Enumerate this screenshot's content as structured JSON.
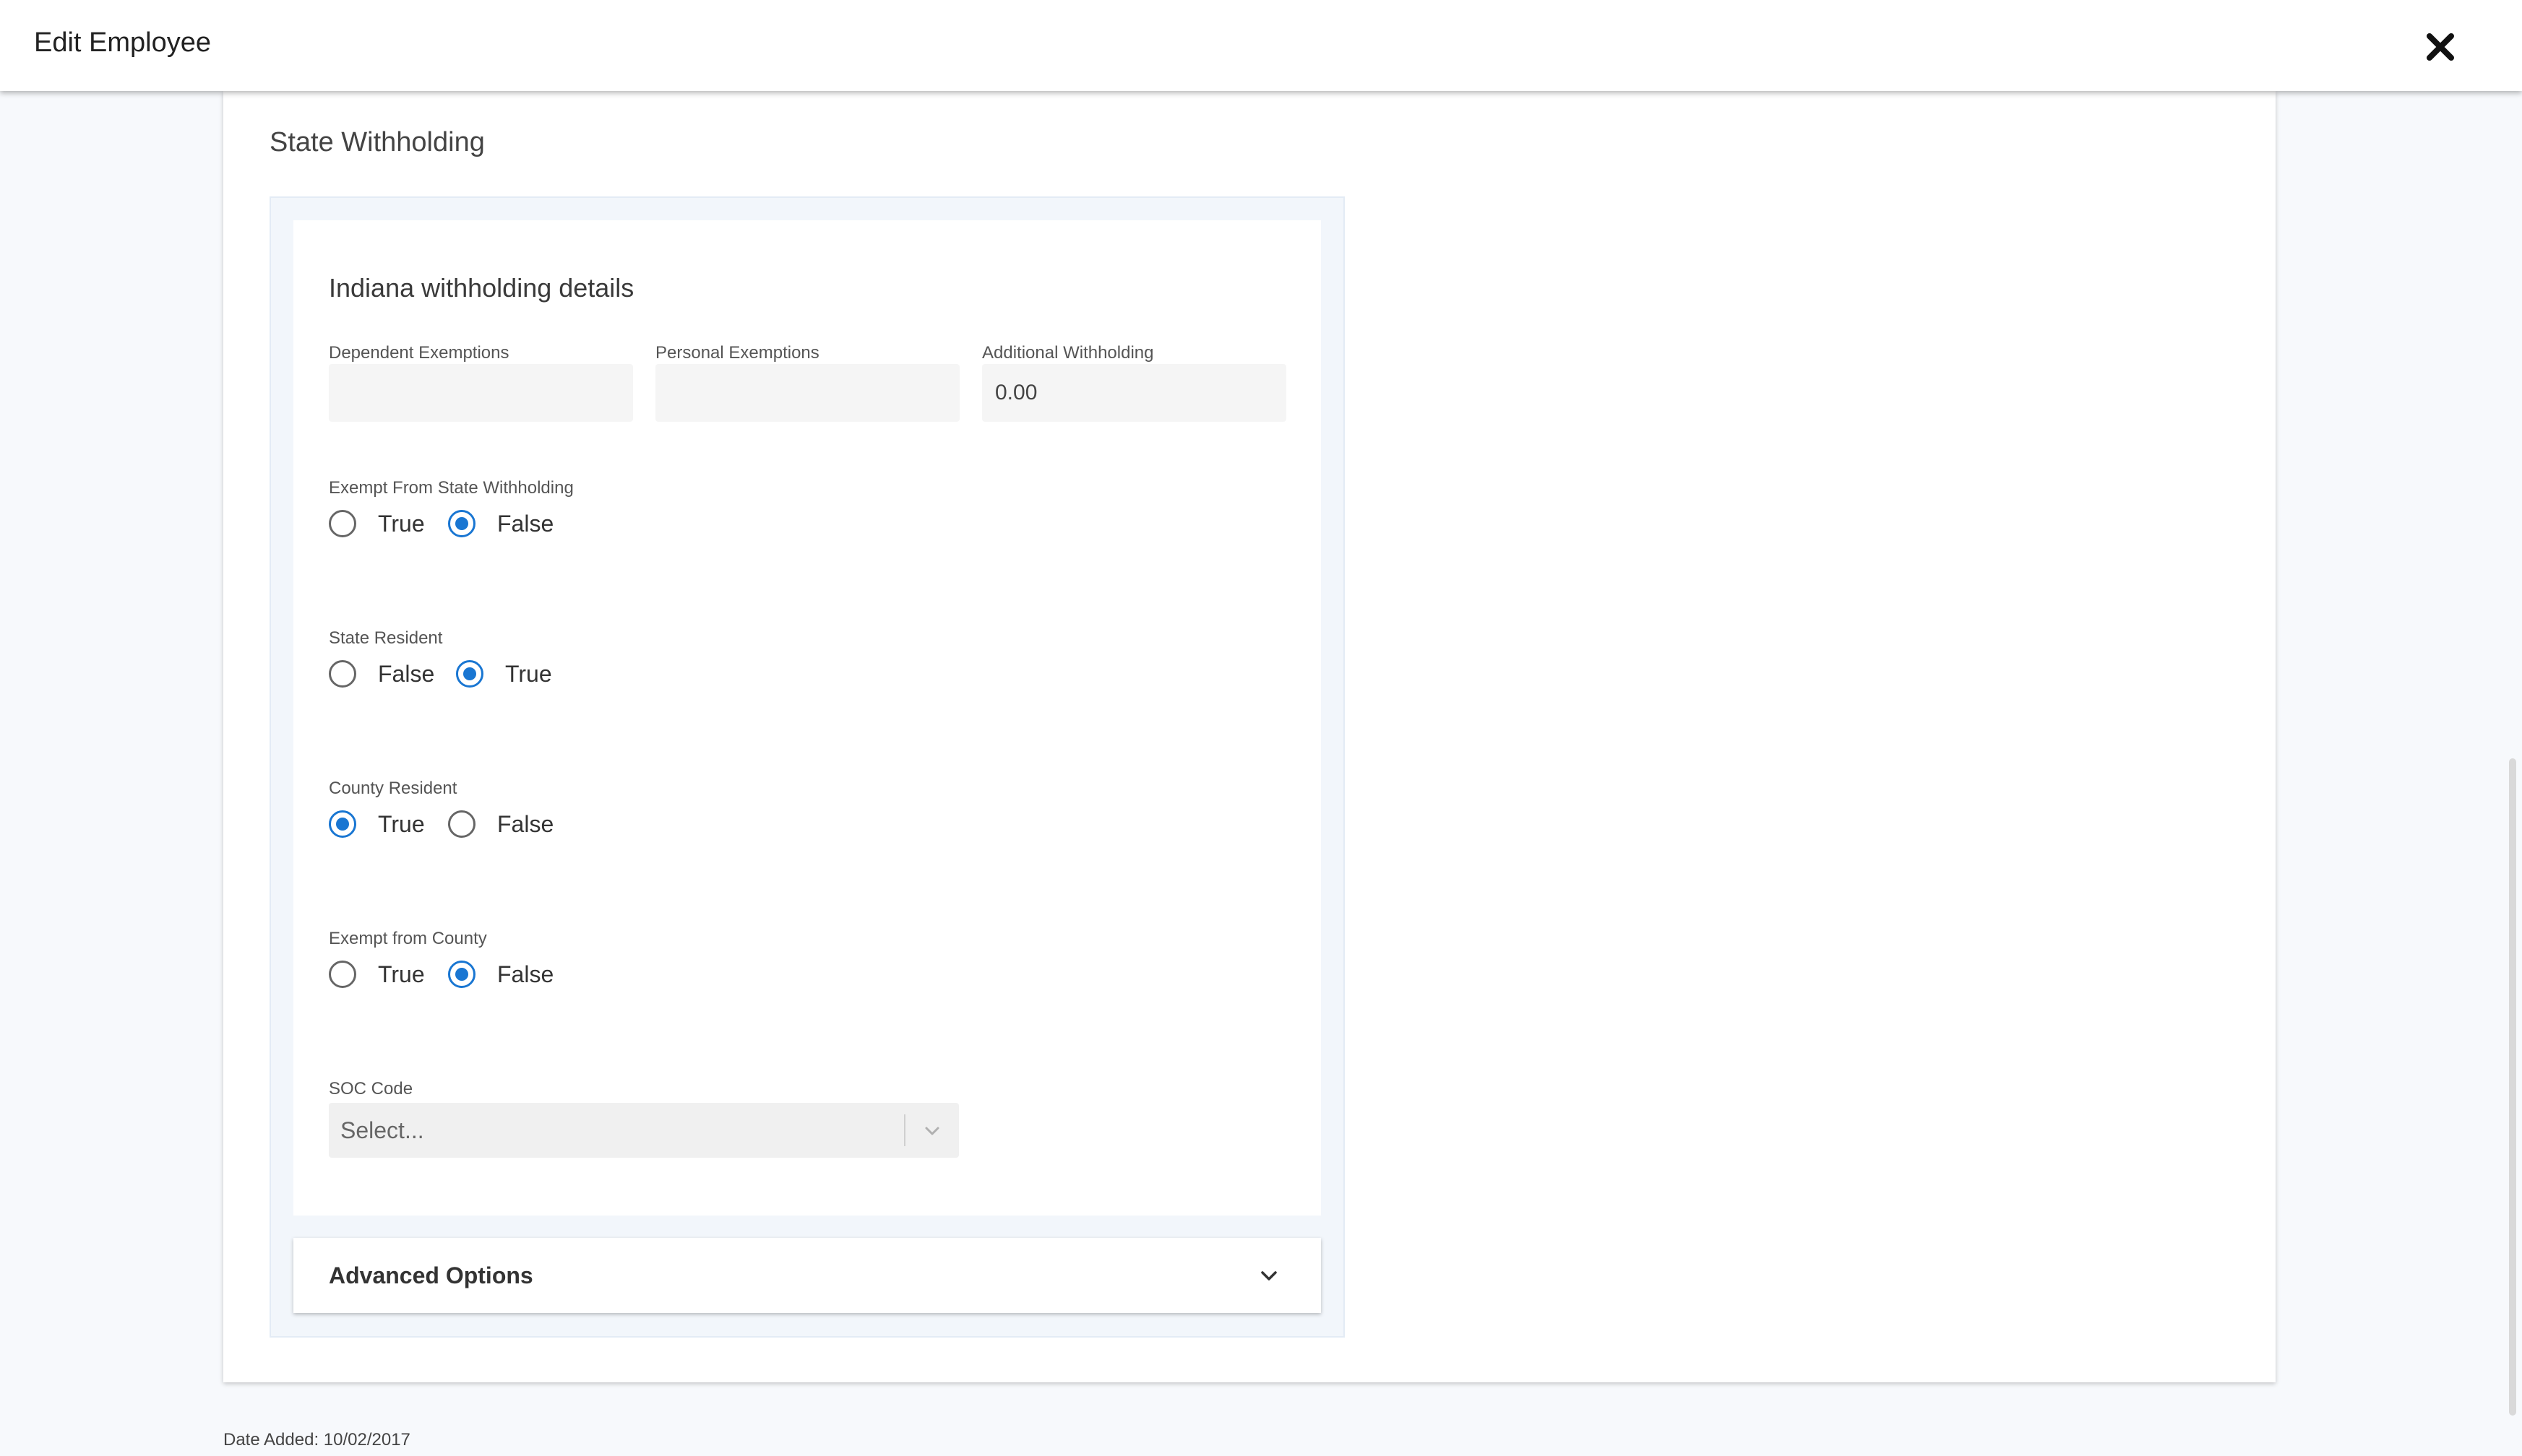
{
  "header": {
    "title": "Edit Employee",
    "close_icon": "close-icon"
  },
  "section": {
    "title": "State Withholding"
  },
  "details": {
    "title": "Indiana withholding details",
    "dependent_exemptions": {
      "label": "Dependent Exemptions",
      "value": ""
    },
    "personal_exemptions": {
      "label": "Personal Exemptions",
      "value": ""
    },
    "additional_withholding": {
      "label": "Additional Withholding",
      "value": "0.00"
    },
    "exempt_state": {
      "label": "Exempt From State Withholding",
      "options": [
        "True",
        "False"
      ],
      "selected": "False"
    },
    "state_resident": {
      "label": "State Resident",
      "options": [
        "False",
        "True"
      ],
      "selected": "True"
    },
    "county_resident": {
      "label": "County Resident",
      "options": [
        "True",
        "False"
      ],
      "selected": "True"
    },
    "exempt_county": {
      "label": "Exempt from County",
      "options": [
        "True",
        "False"
      ],
      "selected": "False"
    },
    "soc_code": {
      "label": "SOC Code",
      "placeholder": "Select..."
    }
  },
  "advanced": {
    "label": "Advanced Options"
  },
  "footer": {
    "date_added": "Date Added: 10/02/2017"
  },
  "colors": {
    "accent": "#1976d2"
  }
}
